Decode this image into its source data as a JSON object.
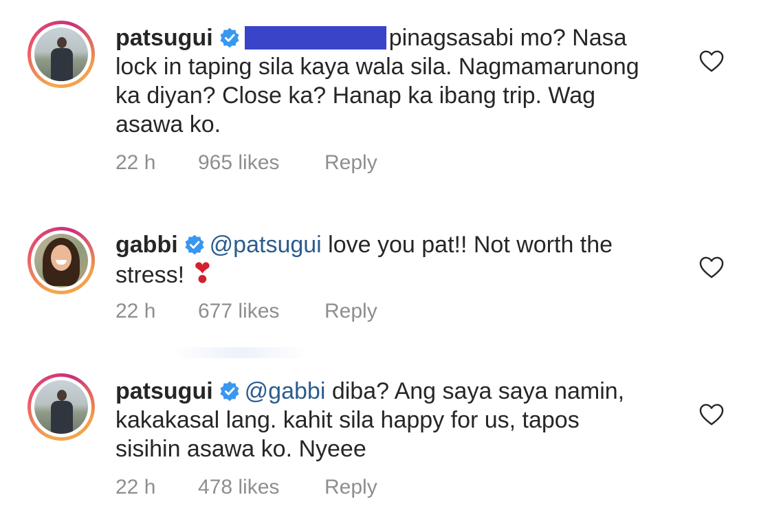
{
  "comments": [
    {
      "username": "patsugui",
      "verified": true,
      "has_redaction": true,
      "text_lines": [
        "pinagsasabi mo? Nasa",
        "lock in taping sila kaya wala sila. Nagmamarunong",
        "ka diyan? Close ka? Hanap ka ibang trip. Wag",
        "asawa ko."
      ],
      "time": "22 h",
      "likes": "965 likes",
      "reply_label": "Reply",
      "avatar": "avatar-patsugui"
    },
    {
      "username": "gabbi",
      "verified": true,
      "mention": "@patsugui",
      "text_lines": [
        " love you pat!! Not worth the",
        "stress! "
      ],
      "emoji": "❣",
      "time": "22 h",
      "likes": "677 likes",
      "reply_label": "Reply",
      "avatar": "avatar-gabbi"
    },
    {
      "username": "patsugui",
      "verified": true,
      "mention": "@gabbi",
      "text_lines": [
        " diba? Ang saya saya namin,",
        "kakakasal lang. kahit sila happy for us, tapos",
        "sisihin asawa ko. Nyeee"
      ],
      "time": "22 h",
      "likes": "478 likes",
      "reply_label": "Reply",
      "avatar": "avatar-patsugui"
    }
  ],
  "colors": {
    "text": "#262626",
    "meta": "#8e8e8e",
    "mention": "#2b5c8f",
    "verified": "#3897f0",
    "redaction": "#3a44c8",
    "avatar_ring": "#e8536b"
  },
  "icons": {
    "verified": "verified-badge-icon",
    "like": "heart-outline-icon"
  }
}
